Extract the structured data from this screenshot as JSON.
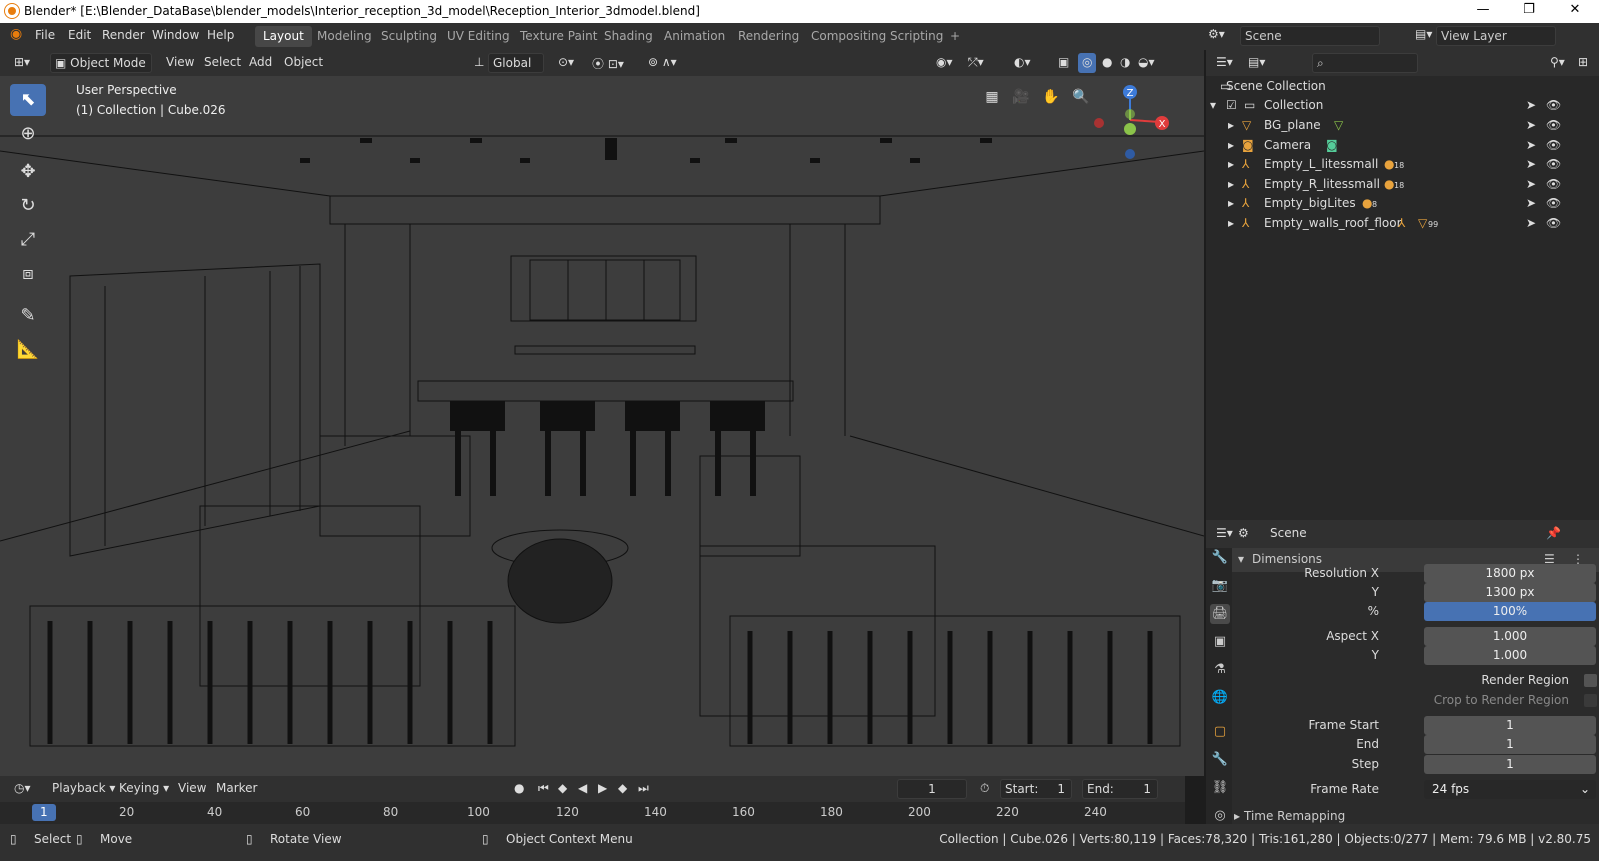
{
  "window": {
    "title": "Blender* [E:\\Blender_DataBase\\blender_models\\Interior_reception_3d_model\\Reception_Interior_3dmodel.blend]",
    "minimize": "—",
    "restore": "❐",
    "close": "✕"
  },
  "menu": {
    "items": [
      "File",
      "Edit",
      "Render",
      "Window",
      "Help"
    ]
  },
  "workspaces": {
    "tabs": [
      "Layout",
      "Modeling",
      "Sculpting",
      "UV Editing",
      "Texture Paint",
      "Shading",
      "Animation",
      "Rendering",
      "Compositing",
      "Scripting"
    ],
    "active": "Layout",
    "add": "+"
  },
  "scene": {
    "label": "Scene",
    "view_layer": "View Layer"
  },
  "viewport_header": {
    "mode": "Object Mode",
    "view": "View",
    "select": "Select",
    "add": "Add",
    "object": "Object",
    "orientation": "Global"
  },
  "viewport": {
    "perspective": "User Perspective",
    "collection_info": "(1) Collection | Cube.026",
    "gizmo": {
      "z": "Z",
      "x": "X",
      "y": "Y"
    }
  },
  "outliner": {
    "root": "Scene Collection",
    "collection": "Collection",
    "items": [
      {
        "name": "BG_plane",
        "badge": ""
      },
      {
        "name": "Camera",
        "badge": ""
      },
      {
        "name": "Empty_L_litessmall",
        "badge": "18"
      },
      {
        "name": "Empty_R_litessmall",
        "badge": "18"
      },
      {
        "name": "Empty_bigLites",
        "badge": "8"
      },
      {
        "name": "Empty_walls_roof_floor",
        "badge": "99"
      }
    ]
  },
  "properties": {
    "context": "Scene",
    "panel": "Dimensions",
    "resolution_x_label": "Resolution X",
    "resolution_x": "1800 px",
    "resolution_y_label": "Y",
    "resolution_y": "1300 px",
    "percent_label": "%",
    "percent": "100%",
    "aspect_x_label": "Aspect X",
    "aspect_x": "1.000",
    "aspect_y_label": "Y",
    "aspect_y": "1.000",
    "render_region": "Render Region",
    "crop_region": "Crop to Render Region",
    "frame_start_label": "Frame Start",
    "frame_start": "1",
    "end_label": "End",
    "end": "1",
    "step_label": "Step",
    "step": "1",
    "frame_rate_label": "Frame Rate",
    "frame_rate": "24 fps",
    "time_remapping": "Time Remapping"
  },
  "timeline": {
    "playback": "Playback",
    "keying": "Keying",
    "view": "View",
    "marker": "Marker",
    "current_frame": "1",
    "start_label": "Start:",
    "start": "1",
    "end_label": "End:",
    "end": "1",
    "ticks": [
      "1",
      "20",
      "40",
      "60",
      "80",
      "100",
      "120",
      "140",
      "160",
      "180",
      "200",
      "220",
      "240"
    ]
  },
  "statusbar": {
    "select": "Select",
    "move": "Move",
    "rotate": "Rotate View",
    "context_menu": "Object Context Menu",
    "stats": "Collection | Cube.026 | Verts:80,119 | Faces:78,320 | Tris:161,280 | Objects:0/277 | Mem: 79.6 MB | v2.80.75"
  },
  "colors": {
    "accent": "#4772b3",
    "x_axis": "#e03c3c",
    "y_axis": "#8bc34a",
    "z_axis": "#3d7bd9",
    "brand": "#e87d0d"
  }
}
